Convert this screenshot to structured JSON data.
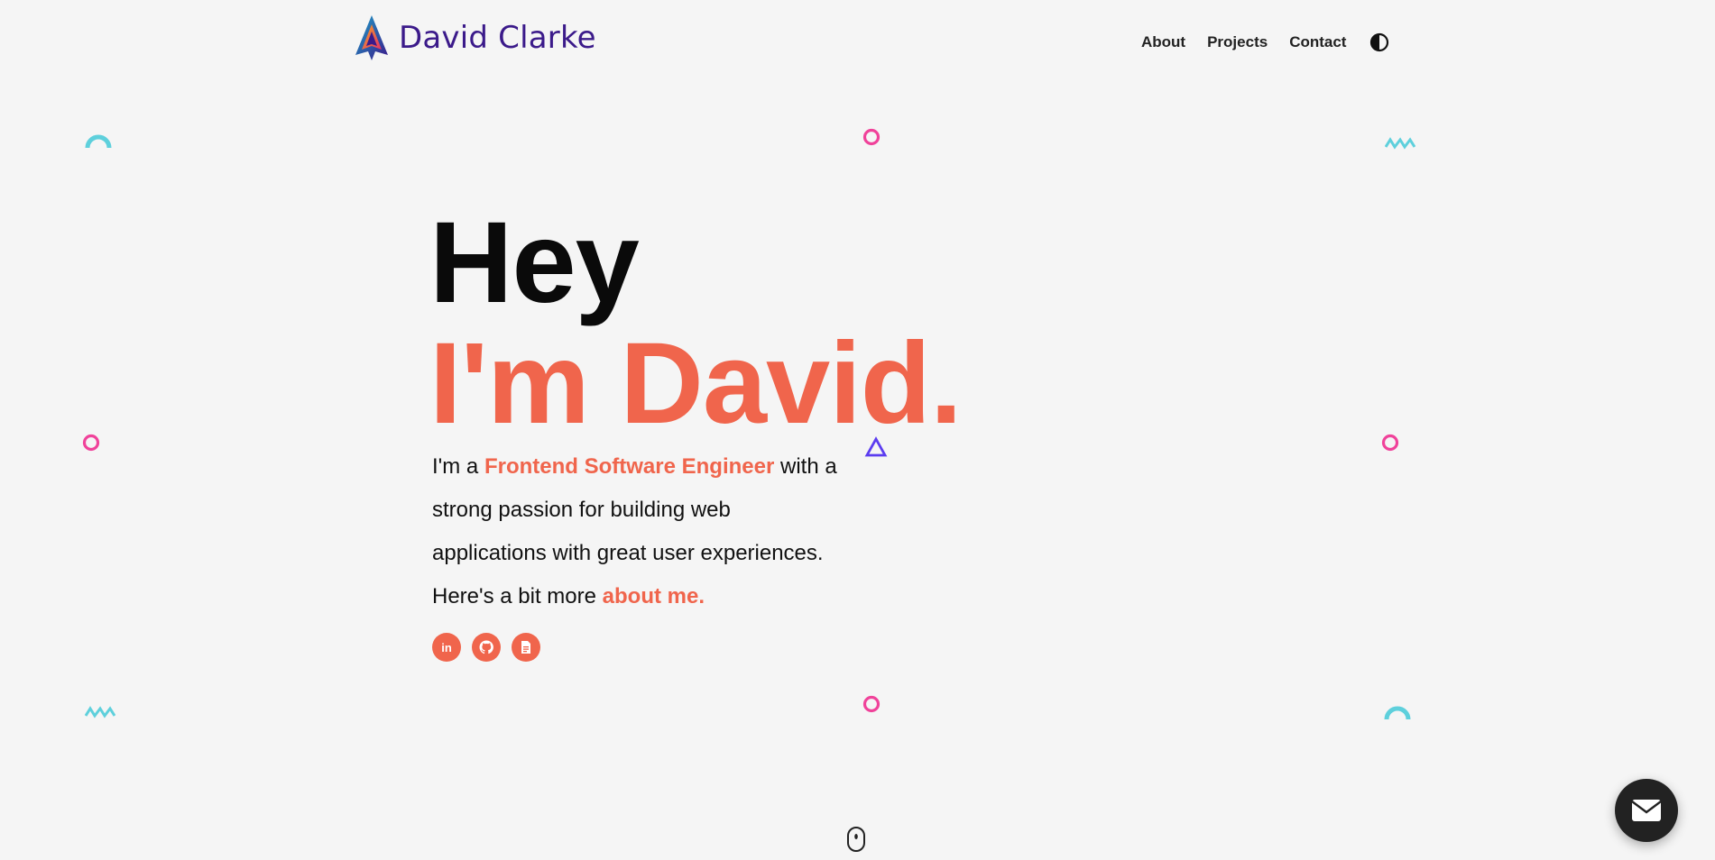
{
  "brand": {
    "name": "David Clarke",
    "color": "#3b1a8a"
  },
  "nav": {
    "items": [
      "About",
      "Projects",
      "Contact"
    ],
    "theme_toggle_icon": "half-circle-contrast-icon"
  },
  "hero": {
    "line1": "Hey",
    "line2": "I'm David.",
    "desc_prefix": "I'm a ",
    "desc_highlight": "Frontend Software Engineer",
    "desc_middle": " with a strong passion for building web applications with great user experiences. Here's a bit more ",
    "about_link": "about me.",
    "accent_color": "#f0654c"
  },
  "socials": [
    {
      "name": "linkedin",
      "label": "in",
      "icon": "linkedin-icon"
    },
    {
      "name": "github",
      "icon": "github-icon"
    },
    {
      "name": "resume",
      "icon": "document-icon"
    }
  ],
  "icons": {
    "scroll": "mouse-scroll-icon",
    "mail": "envelope-icon"
  },
  "colors": {
    "background": "#f5f5f5",
    "accent": "#f0654c",
    "teal": "#5ed0dc",
    "pink": "#f0429a",
    "purple": "#5b3cf0"
  }
}
